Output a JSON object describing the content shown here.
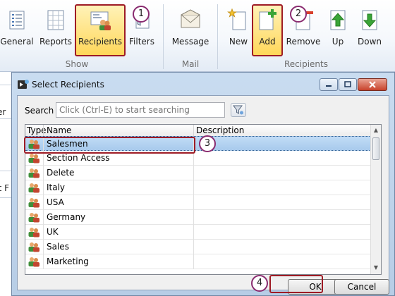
{
  "ribbon": {
    "buttons": [
      {
        "id": "general",
        "label": "General",
        "icon": "document-list-icon"
      },
      {
        "id": "reports",
        "label": "Reports",
        "icon": "report-grid-icon"
      },
      {
        "id": "recipients",
        "label": "Recipients",
        "icon": "recipients-card-icon"
      },
      {
        "id": "filters",
        "label": "Filters",
        "icon": "filter-funnel-icon"
      },
      {
        "id": "message",
        "label": "Message",
        "icon": "envelope-icon"
      },
      {
        "id": "new",
        "label": "New",
        "icon": "new-document-star-icon"
      },
      {
        "id": "add",
        "label": "Add",
        "icon": "add-document-plus-icon"
      },
      {
        "id": "remove",
        "label": "Remove",
        "icon": "remove-document-minus-icon"
      },
      {
        "id": "up",
        "label": "Up",
        "icon": "arrow-up-icon"
      },
      {
        "id": "down",
        "label": "Down",
        "icon": "arrow-down-icon"
      }
    ],
    "groups": [
      "Show",
      "Mail",
      "Recipients"
    ]
  },
  "background_app": {
    "fragments": [
      "er",
      "nt F"
    ]
  },
  "dialog": {
    "title": "Select Recipients",
    "search_label": "Search",
    "search_placeholder": "Click (Ctrl-E) to start searching",
    "columns": [
      "Type",
      "Name",
      "Description"
    ],
    "rows": [
      {
        "name": "Salesmen",
        "selected": true
      },
      {
        "name": "Section Access"
      },
      {
        "name": "Delete"
      },
      {
        "name": "Italy"
      },
      {
        "name": "USA"
      },
      {
        "name": "Germany"
      },
      {
        "name": "UK"
      },
      {
        "name": "Sales"
      },
      {
        "name": "Marketing"
      }
    ],
    "ok_label": "OK",
    "cancel_label": "Cancel"
  },
  "callouts": [
    "1",
    "2",
    "3",
    "4"
  ],
  "colors": {
    "highlight_outline": "#9e1b25",
    "selection": "#a8caec",
    "callout_border": "#8a2b70"
  }
}
